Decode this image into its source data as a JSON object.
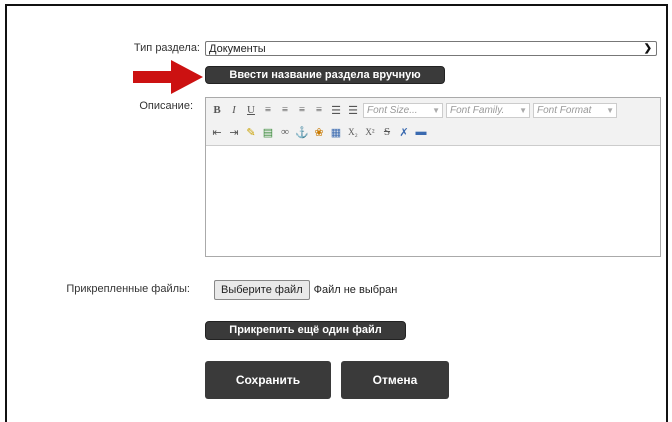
{
  "form": {
    "section_type_label": "Тип раздела:",
    "section_type_value": "Документы",
    "manual_name_button": "Ввести название раздела вручную",
    "description_label": "Описание:",
    "attached_files_label": "Прикрепленные файлы:",
    "file_choose_button": "Выберите файл",
    "file_status": "Файл не выбран",
    "attach_more_button": "Прикрепить ещё один файл",
    "save_button": "Сохранить",
    "cancel_button": "Отмена"
  },
  "editor": {
    "font_size_placeholder": "Font Size...",
    "font_family_placeholder": "Font Family.",
    "font_format_placeholder": "Font Format",
    "toolbar_row1": [
      {
        "icon": "bold-icon",
        "glyph": "B"
      },
      {
        "icon": "italic-icon",
        "glyph": "I"
      },
      {
        "icon": "underline-icon",
        "glyph": "U"
      },
      {
        "icon": "align-left-icon",
        "glyph": "≡"
      },
      {
        "icon": "align-center-icon",
        "glyph": "≡"
      },
      {
        "icon": "align-right-icon",
        "glyph": "≡"
      },
      {
        "icon": "align-justify-icon",
        "glyph": "≡"
      },
      {
        "icon": "ordered-list-icon",
        "glyph": "☰"
      },
      {
        "icon": "unordered-list-icon",
        "glyph": "☰"
      }
    ],
    "toolbar_row2": [
      {
        "icon": "outdent-icon",
        "glyph": "⇤"
      },
      {
        "icon": "indent-icon",
        "glyph": "⇥"
      },
      {
        "icon": "edit-icon",
        "glyph": "✎"
      },
      {
        "icon": "paste-icon",
        "glyph": "▤"
      },
      {
        "icon": "link-icon",
        "glyph": "∞"
      },
      {
        "icon": "anchor-icon",
        "glyph": "⚓"
      },
      {
        "icon": "image-icon",
        "glyph": "❀"
      },
      {
        "icon": "html-icon",
        "glyph": "▦"
      },
      {
        "icon": "subscript-icon",
        "glyph": "X₂"
      },
      {
        "icon": "superscript-icon",
        "glyph": "X²"
      },
      {
        "icon": "strikethrough-icon",
        "glyph": "S"
      },
      {
        "icon": "clean-icon",
        "glyph": "✗"
      },
      {
        "icon": "horizontal-rule-icon",
        "glyph": "▬"
      }
    ]
  },
  "colors": {
    "dark_button": "#3a3a3a",
    "arrow": "#cc1111"
  }
}
